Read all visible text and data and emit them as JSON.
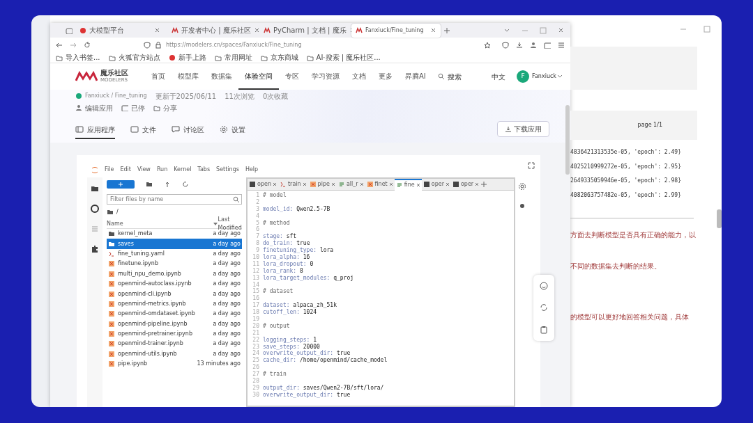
{
  "browser": {
    "tabs": [
      {
        "label": "大模型平台",
        "selected": false
      },
      {
        "label": "开发者中心 | 魔乐社区",
        "selected": false
      },
      {
        "label": "PyCharm | 文档 | 魔乐",
        "selected": false
      },
      {
        "label": "Fanxiuck/Fine_tuning",
        "selected": true
      }
    ],
    "url": "https://modelers.cn/spaces/Fanxiuck/Fine_tuning",
    "bookmarks": [
      "导入书签...",
      "火狐官方站点",
      "新手上路",
      "常用网址",
      "京东商城",
      "AI·搜索 | 魔乐社区..."
    ]
  },
  "site": {
    "logo_name": "魔乐社区",
    "logo_sub": "MODELERS",
    "nav": [
      {
        "label": "首页",
        "selected": false
      },
      {
        "label": "模型库",
        "selected": false
      },
      {
        "label": "数据集",
        "selected": false
      },
      {
        "label": "体验空间",
        "selected": true
      },
      {
        "label": "专区",
        "selected": false
      },
      {
        "label": "学习资源",
        "selected": false
      },
      {
        "label": "文档",
        "selected": false
      },
      {
        "label": "更多",
        "selected": false
      },
      {
        "label": "昇腾AI",
        "selected": false
      }
    ],
    "search_placeholder": "搜索",
    "language": "中文",
    "avatar_letter": "F",
    "user": "Fanxiuck"
  },
  "space": {
    "breadcrumb": "Fanxiuck / Fine_tuning",
    "meta": [
      "更新于2025/06/11",
      "11次浏览",
      "0次收藏"
    ],
    "actions": [
      "编辑应用",
      "已停",
      "分享"
    ],
    "tabs": [
      {
        "label": "应用程序",
        "selected": true
      },
      {
        "label": "文件",
        "selected": false
      },
      {
        "label": "讨论区",
        "selected": false
      },
      {
        "label": "设置",
        "selected": false
      }
    ],
    "download_button": "下载应用"
  },
  "jupyter": {
    "menu": [
      "File",
      "Edit",
      "View",
      "Run",
      "Kernel",
      "Tabs",
      "Settings",
      "Help"
    ],
    "filter_placeholder": "Filter files by name",
    "path": "/",
    "columns": [
      "Name",
      "Last Modified"
    ],
    "files": [
      {
        "name": "kernel_meta",
        "kind": "folder",
        "modified": "a day ago",
        "selected": false
      },
      {
        "name": "saves",
        "kind": "folder",
        "modified": "a day ago",
        "selected": true
      },
      {
        "name": "fine_tuning.yaml",
        "kind": "yaml",
        "modified": "a day ago",
        "selected": false
      },
      {
        "name": "finetune.ipynb",
        "kind": "notebook",
        "modified": "a day ago",
        "selected": false
      },
      {
        "name": "multi_npu_demo.ipynb",
        "kind": "notebook",
        "modified": "a day ago",
        "selected": false
      },
      {
        "name": "openmind-autoclass.ipynb",
        "kind": "notebook",
        "modified": "a day ago",
        "selected": false
      },
      {
        "name": "openmind-cli.ipynb",
        "kind": "notebook",
        "modified": "a day ago",
        "selected": false
      },
      {
        "name": "openmind-metrics.ipynb",
        "kind": "notebook",
        "modified": "a day ago",
        "selected": false
      },
      {
        "name": "openmind-omdataset.ipynb",
        "kind": "notebook",
        "modified": "a day ago",
        "selected": false
      },
      {
        "name": "openmind-pipeline.ipynb",
        "kind": "notebook",
        "modified": "a day ago",
        "selected": false
      },
      {
        "name": "openmind-pretrainer.ipynb",
        "kind": "notebook",
        "modified": "a day ago",
        "selected": false
      },
      {
        "name": "openmind-trainer.ipynb",
        "kind": "notebook",
        "modified": "a day ago",
        "selected": false
      },
      {
        "name": "openmind-utils.ipynb",
        "kind": "notebook",
        "modified": "a day ago",
        "selected": false
      },
      {
        "name": "pipe.ipynb",
        "kind": "notebook",
        "modified": "13 minutes ago",
        "selected": false
      }
    ],
    "editor_tabs": [
      {
        "label": "open",
        "kind": "console",
        "selected": false
      },
      {
        "label": "train",
        "kind": "yaml",
        "selected": false
      },
      {
        "label": "pipe",
        "kind": "notebook",
        "selected": false
      },
      {
        "label": "all_r",
        "kind": "text",
        "selected": false
      },
      {
        "label": "finet",
        "kind": "notebook",
        "selected": false
      },
      {
        "label": "fine",
        "kind": "text",
        "selected": true
      },
      {
        "label": "oper",
        "kind": "console",
        "selected": false
      },
      {
        "label": "oper",
        "kind": "console",
        "selected": false
      }
    ],
    "code": [
      {
        "n": "1",
        "comment": "# model"
      },
      {
        "n": "2"
      },
      {
        "n": "3",
        "key": "model_id:",
        "value": "Qwen2.5-7B"
      },
      {
        "n": "4"
      },
      {
        "n": "5",
        "comment": "# method"
      },
      {
        "n": "6"
      },
      {
        "n": "7",
        "key": "stage:",
        "value": "sft"
      },
      {
        "n": "8",
        "key": "do_train:",
        "value": "true"
      },
      {
        "n": "9",
        "key": "finetuning_type:",
        "value": "lora"
      },
      {
        "n": "10",
        "key": "lora_alpha:",
        "value": "16"
      },
      {
        "n": "11",
        "key": "lora_dropout:",
        "value": "0"
      },
      {
        "n": "12",
        "key": "lora_rank:",
        "value": "8"
      },
      {
        "n": "13",
        "key": "lora_target_modules:",
        "value": "q_proj"
      },
      {
        "n": "14"
      },
      {
        "n": "15",
        "comment": "# dataset"
      },
      {
        "n": "16"
      },
      {
        "n": "17",
        "key": "dataset:",
        "value": "alpaca_zh_51k"
      },
      {
        "n": "18",
        "key": "cutoff_len:",
        "value": "1024"
      },
      {
        "n": "19"
      },
      {
        "n": "20",
        "comment": "# output"
      },
      {
        "n": "21"
      },
      {
        "n": "22",
        "key": "logging_steps:",
        "value": "1"
      },
      {
        "n": "23",
        "key": "save_steps:",
        "value": "20000"
      },
      {
        "n": "24",
        "key": "overwrite_output_dir:",
        "value": "true"
      },
      {
        "n": "25",
        "key": "cache_dir:",
        "value": "/home/openmind/cache_model"
      },
      {
        "n": "26"
      },
      {
        "n": "27",
        "comment": "# train"
      },
      {
        "n": "28"
      },
      {
        "n": "29",
        "key": "output_dir:",
        "value": "saves/Qwen2-7B/sft/lora/"
      },
      {
        "n": "30",
        "key": "overwrite_output_dir:",
        "value": "true"
      }
    ]
  },
  "background_doc": {
    "page_label": "page 1/1",
    "output_lines": [
      "4836421313535e-05, 'epoch': 2.49}",
      "4025210999272e-05, 'epoch': 2.95}",
      "2649335059946e-05, 'epoch': 2.98}",
      "4082063757482e-05, 'epoch': 2.99}"
    ],
    "notes": [
      "方面去判断模型是否具有正确的能力，以",
      "不同的数据集去判断的结果。",
      "的模型可以更好地回答相关问题，具体"
    ]
  }
}
